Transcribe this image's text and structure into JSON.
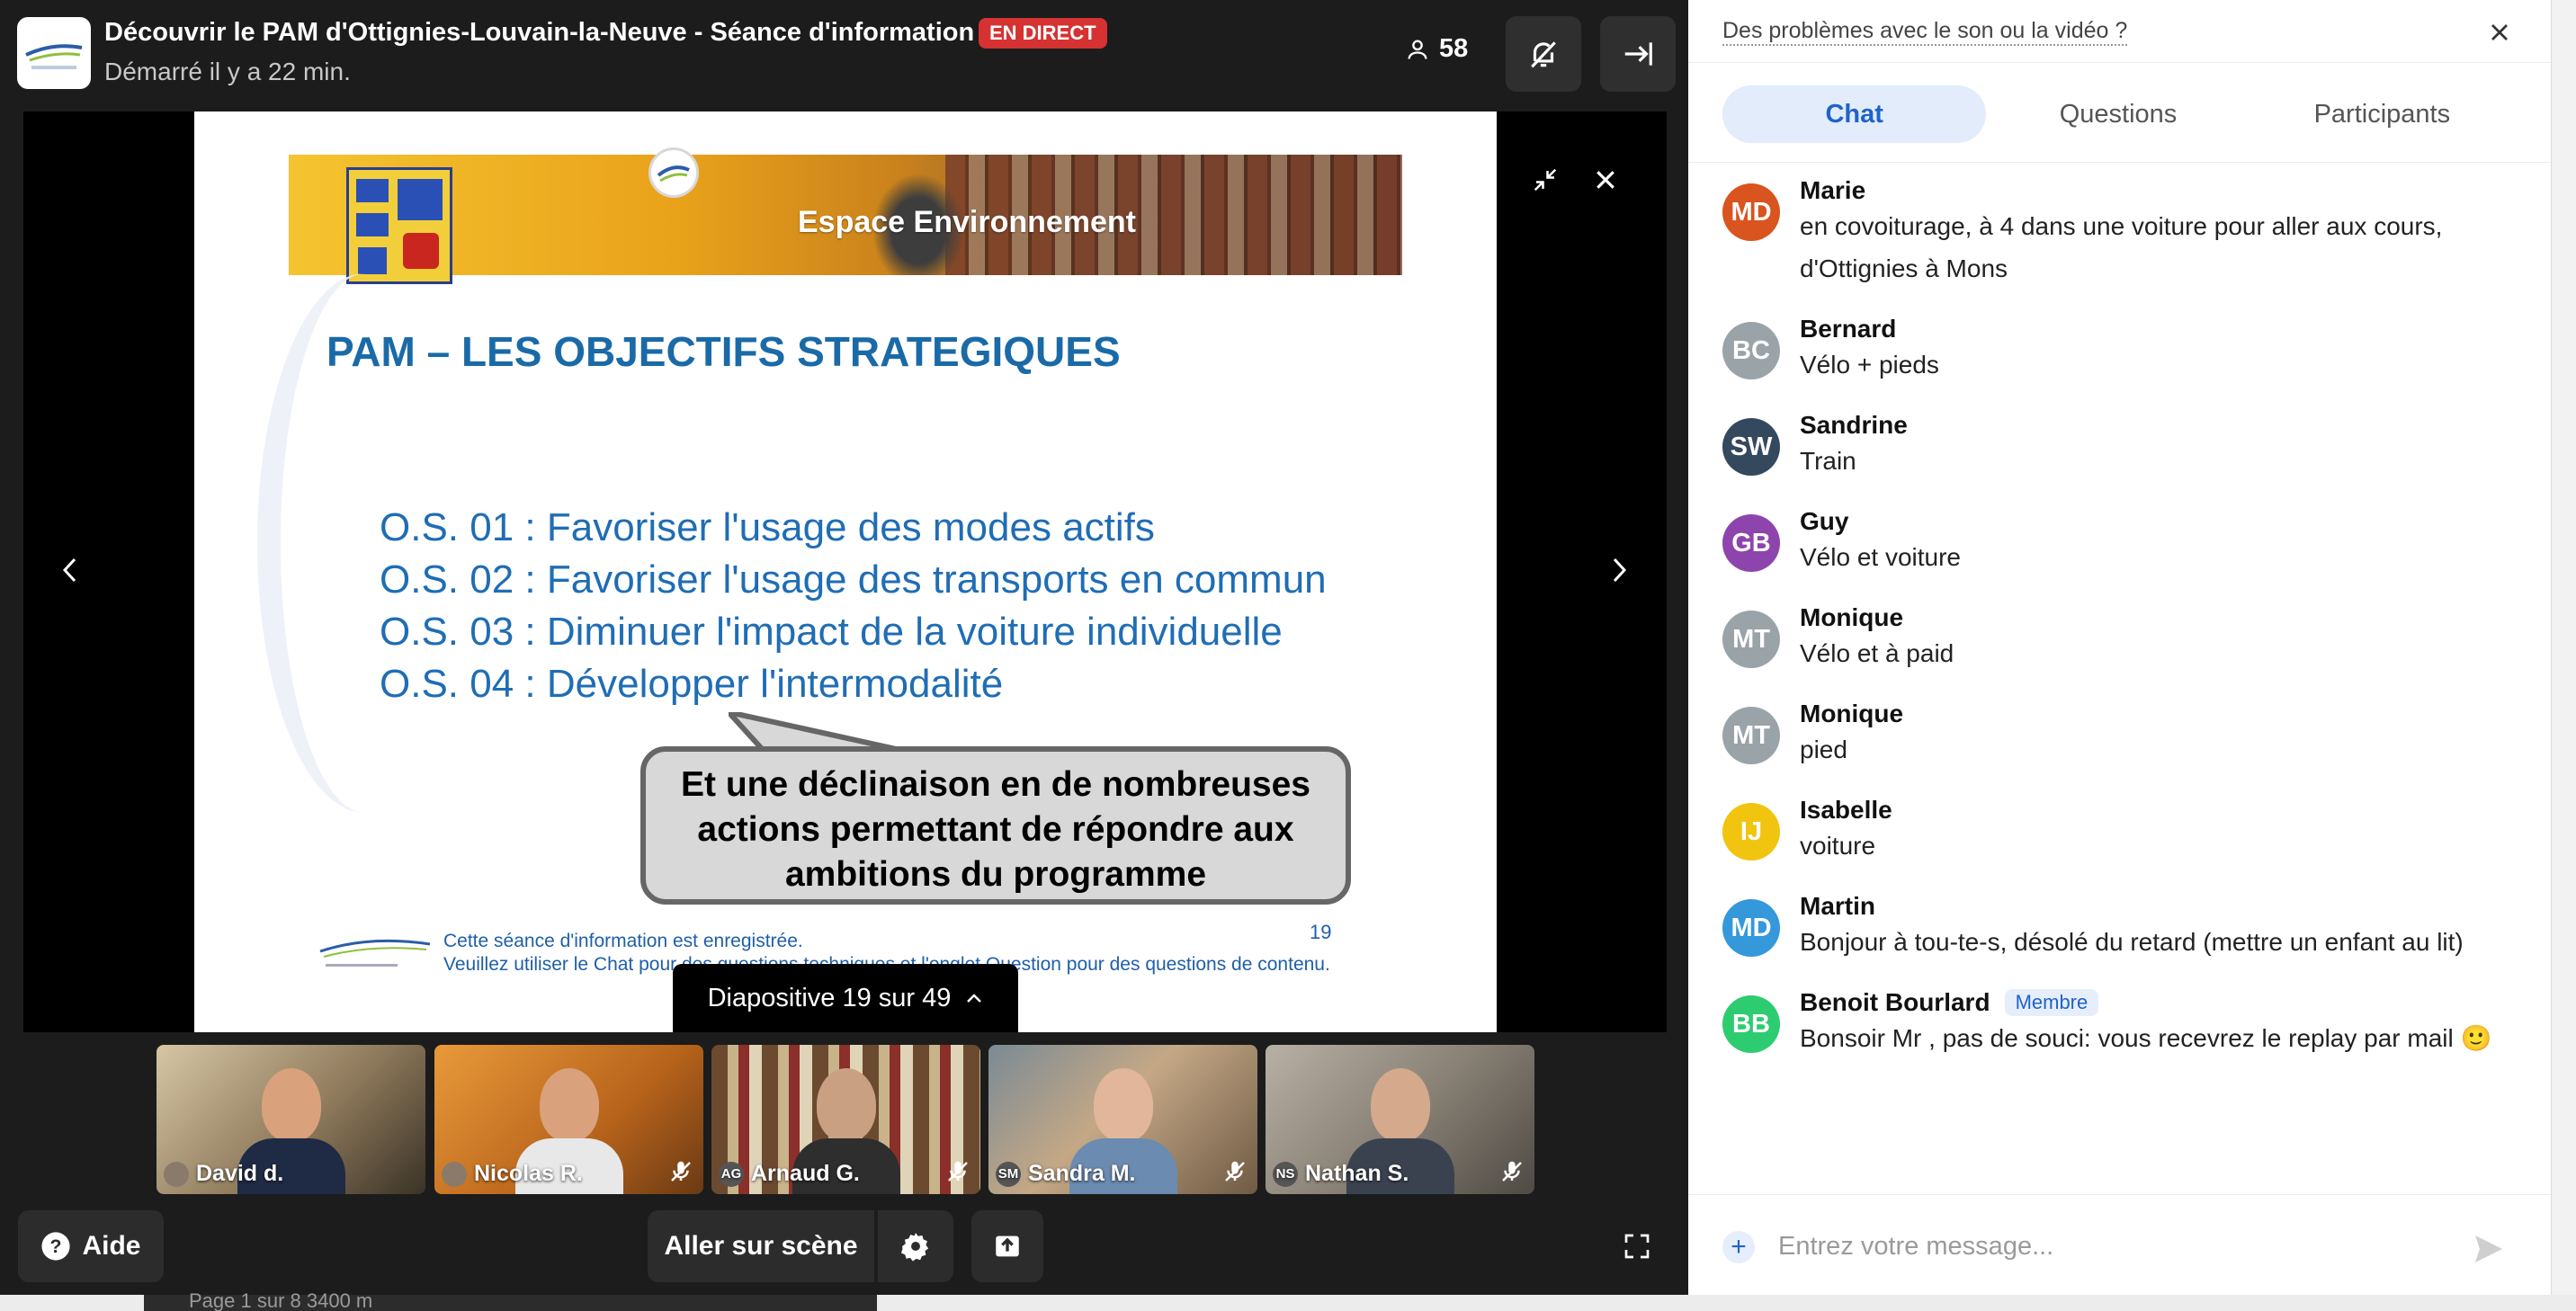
{
  "header": {
    "title": "Découvrir le PAM d'Ottignies-Louvain-la-Neuve - Séance d'information",
    "live_badge": "EN DIRECT",
    "subtitle": "Démarré il y a 22 min.",
    "participant_count": "58"
  },
  "slide": {
    "banner_title": "Espace Environnement",
    "title": "PAM – LES OBJECTIFS STRATEGIQUES",
    "objectives": [
      "O.S. 01 : Favoriser l'usage des modes actifs",
      "O.S. 02 : Favoriser l'usage des transports en commun",
      "O.S. 03 : Diminuer l'impact de la voiture individuelle",
      "O.S. 04 : Développer l'intermodalité"
    ],
    "callout": "Et une déclinaison en de nombreuses actions permettant de répondre aux ambitions du programme",
    "footer_line1": "Cette séance d'information est enregistrée.",
    "footer_line2": "Veuillez utiliser le Chat pour des questions techniques et l'onglet Question pour des questions de contenu.",
    "number": "19",
    "pill": "Diapositive 19 sur 49"
  },
  "participants": [
    {
      "name": "David d.",
      "initials": ""
    },
    {
      "name": "Nicolas R.",
      "initials": ""
    },
    {
      "name": "Arnaud G.",
      "initials": "AG"
    },
    {
      "name": "Sandra M.",
      "initials": "SM"
    },
    {
      "name": "Nathan S.",
      "initials": "NS"
    }
  ],
  "controls": {
    "help": "Aide",
    "go_on_stage": "Aller sur scène"
  },
  "bottom_strip": {
    "text": "Page 1 sur 8     3400 m"
  },
  "panel": {
    "problem_link": "Des problèmes avec le son ou la vidéo ?",
    "tabs": [
      "Chat",
      "Questions",
      "Participants"
    ],
    "messages": [
      {
        "initials": "MD",
        "color": "#d9541e",
        "name": "Marie",
        "text": "en covoiturage, à 4 dans une voiture pour aller aux cours, d'Ottignies à Mons",
        "badge": ""
      },
      {
        "initials": "BC",
        "color": "#9aa3a8",
        "name": "Bernard",
        "text": "Vélo + pieds",
        "badge": ""
      },
      {
        "initials": "SW",
        "color": "#34495e",
        "name": "Sandrine",
        "text": "Train",
        "badge": ""
      },
      {
        "initials": "GB",
        "color": "#8e44ad",
        "name": "Guy",
        "text": "Vélo et voiture",
        "badge": ""
      },
      {
        "initials": "MT",
        "color": "#9aa3a8",
        "name": "Monique",
        "text": "Vélo et à paid",
        "badge": ""
      },
      {
        "initials": "MT",
        "color": "#9aa3a8",
        "name": "Monique",
        "text": "pied",
        "badge": ""
      },
      {
        "initials": "IJ",
        "color": "#f1c40f",
        "name": "Isabelle",
        "text": "voiture",
        "badge": ""
      },
      {
        "initials": "MD",
        "color": "#3498db",
        "name": "Martin",
        "text": "Bonjour à tou-te-s, désolé du retard (mettre un enfant au lit)",
        "badge": ""
      },
      {
        "initials": "BB",
        "color": "#2ecc71",
        "name": "Benoit Bourlard",
        "text": "Bonsoir Mr            , pas de souci: vous recevrez le replay par mail 🙂",
        "badge": "Membre"
      }
    ],
    "composer_placeholder": "Entrez votre message..."
  }
}
